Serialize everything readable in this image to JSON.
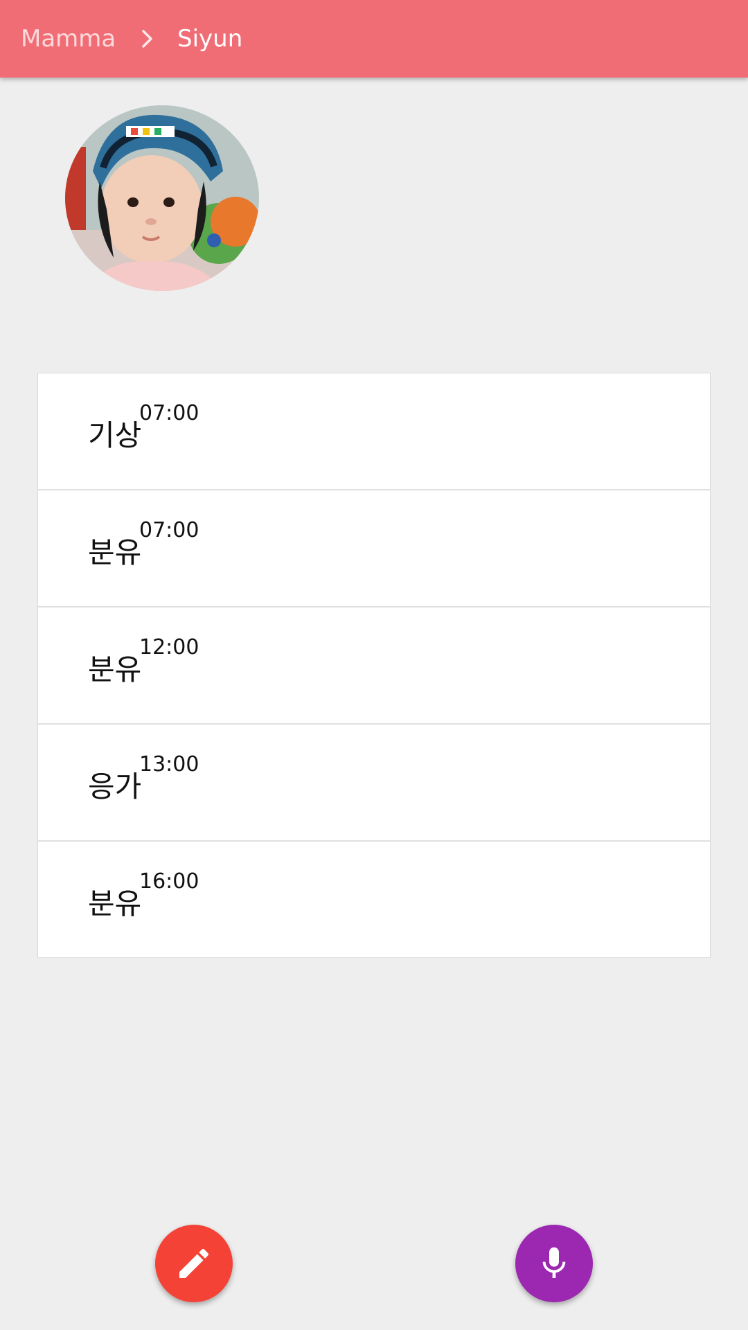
{
  "appbar": {
    "parent_label": "Mamma",
    "current_label": "Siyun",
    "color": "#f06d75"
  },
  "schedule": [
    {
      "label": "기상",
      "time": "07:00"
    },
    {
      "label": "분유",
      "time": "07:00"
    },
    {
      "label": "분유",
      "time": "12:00"
    },
    {
      "label": "응가",
      "time": "13:00"
    },
    {
      "label": "분유",
      "time": "16:00"
    }
  ],
  "actions": {
    "edit": {
      "icon": "pencil-icon",
      "color": "#f44336"
    },
    "voice": {
      "icon": "microphone-icon",
      "color": "#9c27b0"
    }
  }
}
